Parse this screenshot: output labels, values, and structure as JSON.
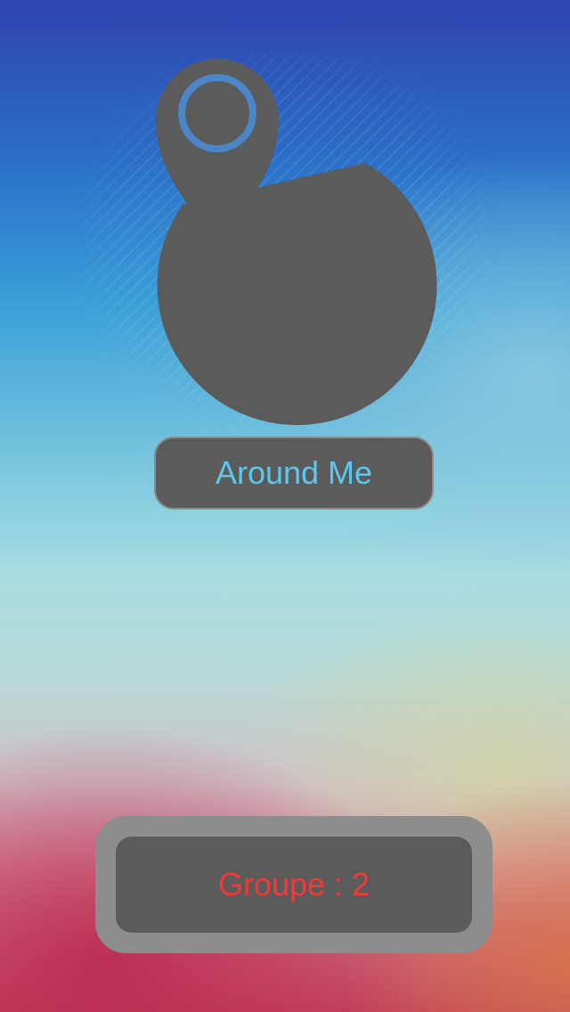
{
  "logo": {
    "icon": "globe-with-map-pin-star-icon",
    "color": "#5b5b5b"
  },
  "around_me_button": {
    "label": "Around Me",
    "text_color": "#5bc8f0"
  },
  "group": {
    "label": "Groupe : 2",
    "text_color": "#f03a3a"
  }
}
